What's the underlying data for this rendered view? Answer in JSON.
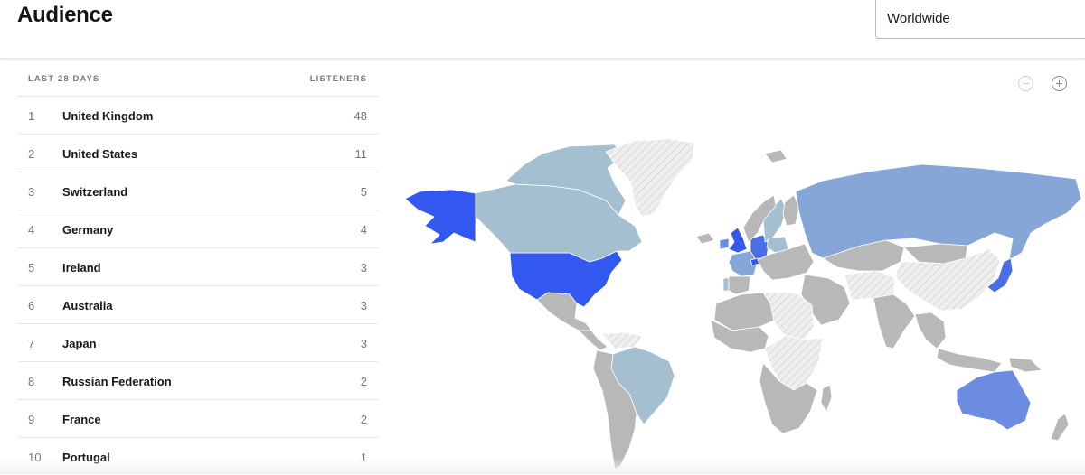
{
  "header": {
    "title": "Audience",
    "region_selector": {
      "value": "Worldwide"
    }
  },
  "table": {
    "period_header": "LAST 28 DAYS",
    "metric_header": "LISTENERS",
    "rows": [
      {
        "rank": "1",
        "country": "United Kingdom",
        "listeners": "48"
      },
      {
        "rank": "2",
        "country": "United States",
        "listeners": "11"
      },
      {
        "rank": "3",
        "country": "Switzerland",
        "listeners": "5"
      },
      {
        "rank": "4",
        "country": "Germany",
        "listeners": "4"
      },
      {
        "rank": "5",
        "country": "Ireland",
        "listeners": "3"
      },
      {
        "rank": "6",
        "country": "Australia",
        "listeners": "3"
      },
      {
        "rank": "7",
        "country": "Japan",
        "listeners": "3"
      },
      {
        "rank": "8",
        "country": "Russian Federation",
        "listeners": "2"
      },
      {
        "rank": "9",
        "country": "France",
        "listeners": "2"
      },
      {
        "rank": "10",
        "country": "Portugal",
        "listeners": "1"
      }
    ]
  },
  "map": {
    "zoom_out_icon": "minus-circle-icon",
    "zoom_in_icon": "plus-circle-icon",
    "colors": {
      "high": "#3358f0",
      "mid_high": "#4a6ee6",
      "mid": "#6b8ce0",
      "low_mid": "#86a6d8",
      "low": "#a3bfd0",
      "no_listeners": "#b8b8b8",
      "no_data": "#ececec",
      "border": "#ffffff"
    },
    "regions": [
      {
        "name": "Alaska",
        "tier": "high"
      },
      {
        "name": "United States",
        "tier": "high"
      },
      {
        "name": "Canada",
        "tier": "low"
      },
      {
        "name": "Canadian Arctic",
        "tier": "low"
      },
      {
        "name": "Greenland",
        "tier": "no_data"
      },
      {
        "name": "Iceland",
        "tier": "no_listeners"
      },
      {
        "name": "Mexico",
        "tier": "no_listeners"
      },
      {
        "name": "Central America",
        "tier": "no_listeners"
      },
      {
        "name": "Brazil",
        "tier": "low"
      },
      {
        "name": "South America West",
        "tier": "no_listeners"
      },
      {
        "name": "Venezuela",
        "tier": "no_data"
      },
      {
        "name": "United Kingdom",
        "tier": "high"
      },
      {
        "name": "Ireland",
        "tier": "mid"
      },
      {
        "name": "France",
        "tier": "low_mid"
      },
      {
        "name": "Germany",
        "tier": "mid_high"
      },
      {
        "name": "Switzerland",
        "tier": "high"
      },
      {
        "name": "Portugal",
        "tier": "low"
      },
      {
        "name": "Spain",
        "tier": "no_listeners"
      },
      {
        "name": "Sweden",
        "tier": "low"
      },
      {
        "name": "Poland",
        "tier": "low"
      },
      {
        "name": "Norway",
        "tier": "no_listeners"
      },
      {
        "name": "Finland",
        "tier": "no_listeners"
      },
      {
        "name": "Eastern Europe",
        "tier": "no_listeners"
      },
      {
        "name": "Russia",
        "tier": "low_mid"
      },
      {
        "name": "Kazakhstan",
        "tier": "no_listeners"
      },
      {
        "name": "Mongolia",
        "tier": "no_listeners"
      },
      {
        "name": "China",
        "tier": "no_data"
      },
      {
        "name": "Middle East",
        "tier": "no_listeners"
      },
      {
        "name": "Iran Afghanistan",
        "tier": "no_data"
      },
      {
        "name": "India",
        "tier": "no_listeners"
      },
      {
        "name": "Southeast Asia",
        "tier": "no_listeners"
      },
      {
        "name": "Japan",
        "tier": "mid_high"
      },
      {
        "name": "North Africa",
        "tier": "no_listeners"
      },
      {
        "name": "Libya Sudan",
        "tier": "no_data"
      },
      {
        "name": "Central Africa",
        "tier": "no_data"
      },
      {
        "name": "West Africa",
        "tier": "no_listeners"
      },
      {
        "name": "Southern Africa",
        "tier": "no_listeners"
      },
      {
        "name": "Madagascar",
        "tier": "no_listeners"
      },
      {
        "name": "Indonesia",
        "tier": "no_listeners"
      },
      {
        "name": "Papua New Guinea",
        "tier": "no_listeners"
      },
      {
        "name": "Australia",
        "tier": "mid"
      },
      {
        "name": "New Zealand",
        "tier": "no_listeners"
      },
      {
        "name": "Svalbard",
        "tier": "no_listeners"
      }
    ]
  }
}
